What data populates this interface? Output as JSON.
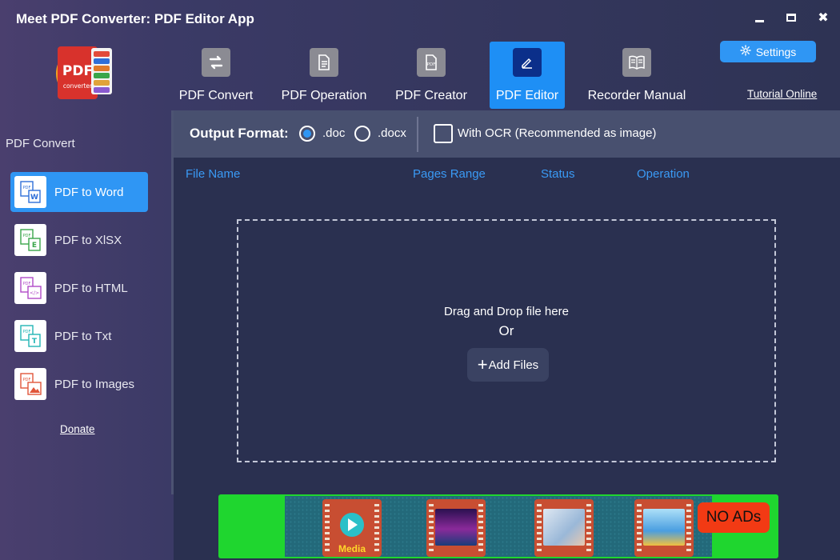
{
  "window": {
    "title": "Meet PDF Converter: PDF Editor App",
    "minimize_icon": "minimize-icon",
    "maximize_icon": "maximize-icon",
    "close_icon": "close-icon",
    "close_glyph": "✖"
  },
  "logo": {
    "main_text": "PDF",
    "sub_text": "converter",
    "badges": [
      "OCR",
      "W",
      "PPT",
      "EXC",
      "TXT",
      "PNG"
    ]
  },
  "nav": {
    "tabs": [
      {
        "label": "PDF Convert",
        "icon": "convert-arrows-icon",
        "active": false
      },
      {
        "label": "PDF Operation",
        "icon": "document-icon",
        "active": false
      },
      {
        "label": "PDF Creator",
        "icon": "pdf-file-icon",
        "active": false
      },
      {
        "label": "PDF Editor",
        "icon": "pencil-edit-icon",
        "active": true
      },
      {
        "label": "Recorder Manual",
        "icon": "book-icon",
        "active": false
      }
    ],
    "settings_label": "Settings",
    "settings_icon": "gear-icon",
    "tutorial_label": "Tutorial Online"
  },
  "sidebar": {
    "title": "PDF Convert",
    "items": [
      {
        "label": "PDF to Word",
        "icon": "pdf-to-word-icon",
        "letter": "W",
        "accent": "#2f6fd8",
        "active": true
      },
      {
        "label": "PDF to XlSX",
        "icon": "pdf-to-xlsx-icon",
        "letter": "E",
        "accent": "#3aa64a",
        "active": false
      },
      {
        "label": "PDF to HTML",
        "icon": "pdf-to-html-icon",
        "letter": "</>",
        "accent": "#b04ac8",
        "active": false
      },
      {
        "label": "PDF to Txt",
        "icon": "pdf-to-txt-icon",
        "letter": "T",
        "accent": "#22b5b5",
        "active": false
      },
      {
        "label": "PDF to Images",
        "icon": "pdf-to-images-icon",
        "letter": "▲",
        "accent": "#e0553a",
        "active": false
      }
    ],
    "donate_label": "Donate"
  },
  "format_bar": {
    "label": "Output Format:",
    "options": [
      {
        "label": ".doc",
        "checked": true
      },
      {
        "label": ".docx",
        "checked": false
      }
    ],
    "ocr_label": "With OCR (Recommended as image)",
    "ocr_checked": false
  },
  "table": {
    "columns": [
      "File Name",
      "Pages Range",
      "Status",
      "Operation"
    ]
  },
  "dropzone": {
    "text": "Drag and Drop file here",
    "or": "Or",
    "add_label": "Add Files",
    "plus": "+"
  },
  "ad": {
    "noads_label": "NO ADs",
    "media_label": "Media",
    "thumbnails": [
      "media-play-icon",
      "galaxy-thumbnail",
      "anime-eye-thumbnail",
      "anime-girl-thumbnail"
    ]
  },
  "colors": {
    "accent_blue": "#2f96f4",
    "active_tab": "#1e8ff5",
    "column_header": "#3a9af5",
    "ad_green": "#1fd62f",
    "noads_red": "#f23a14"
  }
}
